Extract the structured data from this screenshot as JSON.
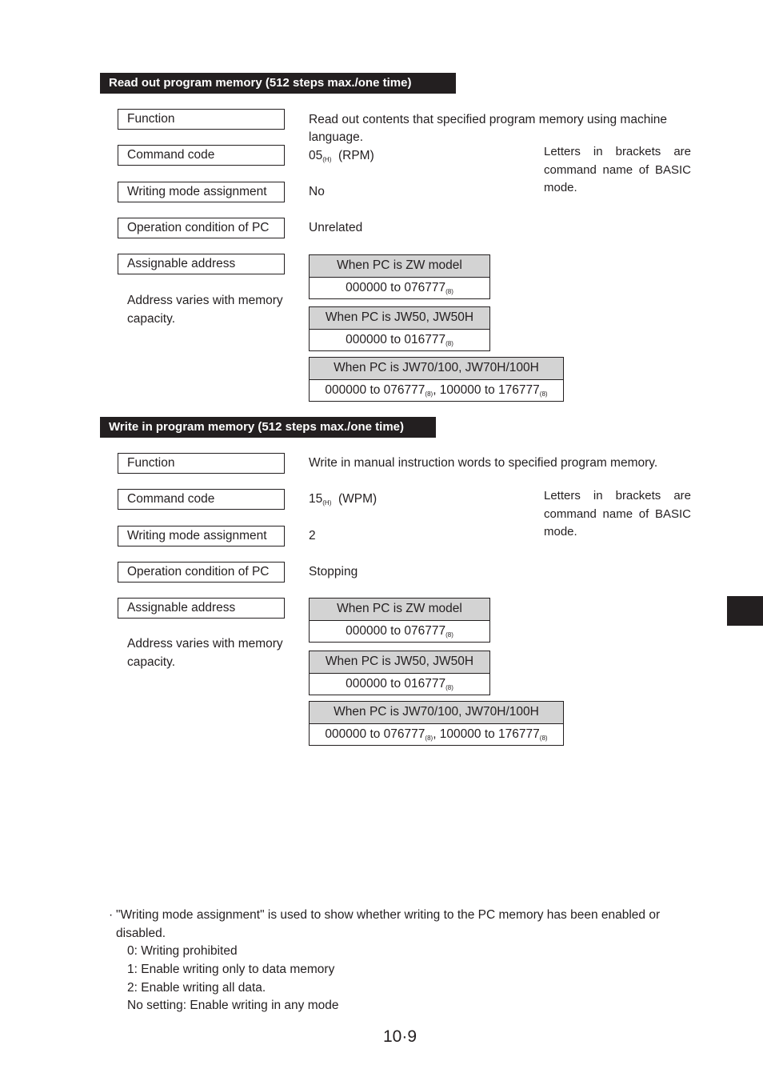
{
  "sections": [
    {
      "title": "Read out program memory (512 steps max./one time)",
      "labels": {
        "function": "Function",
        "command_code": "Command code",
        "writing_mode": "Writing mode assignment",
        "operation_condition": "Operation condition of PC",
        "assignable_address": "Assignable address"
      },
      "function_value": "Read out contents that specified program memory using machine language.",
      "command_code_value": "05",
      "command_code_sub": "(H)",
      "command_code_name": "(RPM)",
      "writing_mode_value": "No",
      "operation_condition_value": "Unrelated",
      "side_note": "Letters in brackets are command name of BASIC mode.",
      "address_note": "Address varies with memory capacity.",
      "address_tables": [
        {
          "header": "When PC is ZW model",
          "range1": "000000 to 076777",
          "sub1": "(8)",
          "range2": "",
          "sub2": ""
        },
        {
          "header": "When PC is JW50, JW50H",
          "range1": "000000 to 016777",
          "sub1": "(8)",
          "range2": "",
          "sub2": ""
        },
        {
          "header": "When PC is JW70/100, JW70H/100H",
          "range1": "000000 to 076777",
          "sub1": "(8)",
          "range2": ", 100000 to 176777",
          "sub2": "(8)"
        }
      ]
    },
    {
      "title": "Write in program memory (512 steps max./one time)",
      "labels": {
        "function": "Function",
        "command_code": "Command code",
        "writing_mode": "Writing mode assignment",
        "operation_condition": "Operation condition of PC",
        "assignable_address": "Assignable address"
      },
      "function_value": "Write in manual instruction words to specified program memory.",
      "command_code_value": "15",
      "command_code_sub": "(H)",
      "command_code_name": "(WPM)",
      "writing_mode_value": "2",
      "operation_condition_value": "Stopping",
      "side_note": "Letters in brackets are command name of BASIC mode.",
      "address_note": "Address varies with memory capacity.",
      "address_tables": [
        {
          "header": "When PC is ZW model",
          "range1": "000000 to 076777",
          "sub1": "(8)",
          "range2": "",
          "sub2": ""
        },
        {
          "header": "When PC is JW50, JW50H",
          "range1": "000000 to 016777",
          "sub1": "(8)",
          "range2": "",
          "sub2": ""
        },
        {
          "header": "When PC is JW70/100, JW70H/100H",
          "range1": "000000 to 076777",
          "sub1": "(8)",
          "range2": ", 100000 to 176777",
          "sub2": "(8)"
        }
      ]
    }
  ],
  "footnote": {
    "bullet": "·",
    "intro": "\"Writing mode assignment\" is used to show whether writing to the PC memory has been enabled or disabled.",
    "items": [
      "0: Writing prohibited",
      "1: Enable writing only to data memory",
      "2: Enable writing all data.",
      "No setting: Enable writing in any mode"
    ]
  },
  "page_number": "10·9"
}
